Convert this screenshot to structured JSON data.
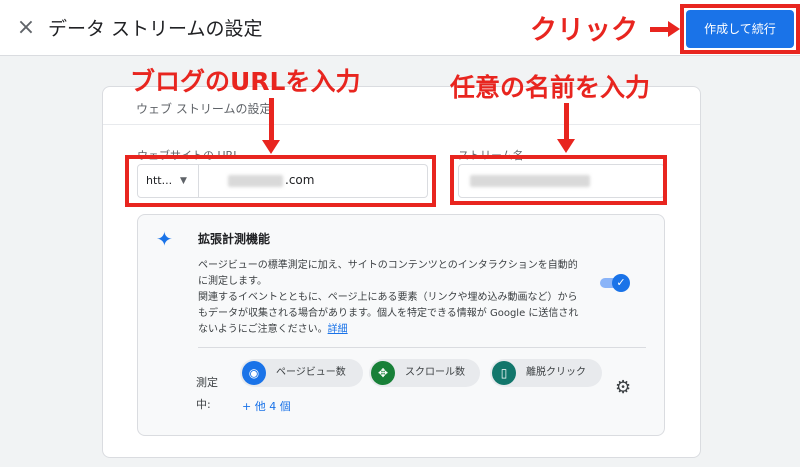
{
  "header": {
    "title": "データ ストリームの設定",
    "close_icon": "×",
    "primary_button": "作成して続行"
  },
  "stream_setup": {
    "section_title": "ウェブ ストリームの設定",
    "url_label": "ウェブサイトの URL",
    "protocol_value": "htt...",
    "url_value_suffix": ".com",
    "name_label": "ストリーム名"
  },
  "enhanced_measurement": {
    "icon": "sparkle-icon",
    "title": "拡張計測機能",
    "description_lines": [
      "ページビューの標準測定に加え、サイトのコンテンツとのインタラクションを自動的",
      "に測定します。",
      "関連するイベントとともに、ページ上にある要素（リンクや埋め込み動画など）から",
      "もデータが収集される場合があります。個人を特定できる情報が Google に送信され",
      "ないようにご注意ください。"
    ],
    "details_link": "詳細",
    "toggle_on": true,
    "measuring_label_line1": "測定",
    "measuring_label_line2": "中:",
    "chips": [
      {
        "label": "ページビュー数",
        "icon": "eye-icon",
        "color": "#1a73e8"
      },
      {
        "label": "スクロール数",
        "icon": "scroll-target-icon",
        "color": "#188038"
      },
      {
        "label": "離脱クリック",
        "icon": "mouse-icon",
        "color": "#12766b"
      }
    ],
    "more_link": "+ 他 4 個"
  },
  "annotations": {
    "click": "クリック",
    "blog_url": "ブログのURLを入力",
    "name": "任意の名前を入力",
    "color": "#e8251f"
  }
}
